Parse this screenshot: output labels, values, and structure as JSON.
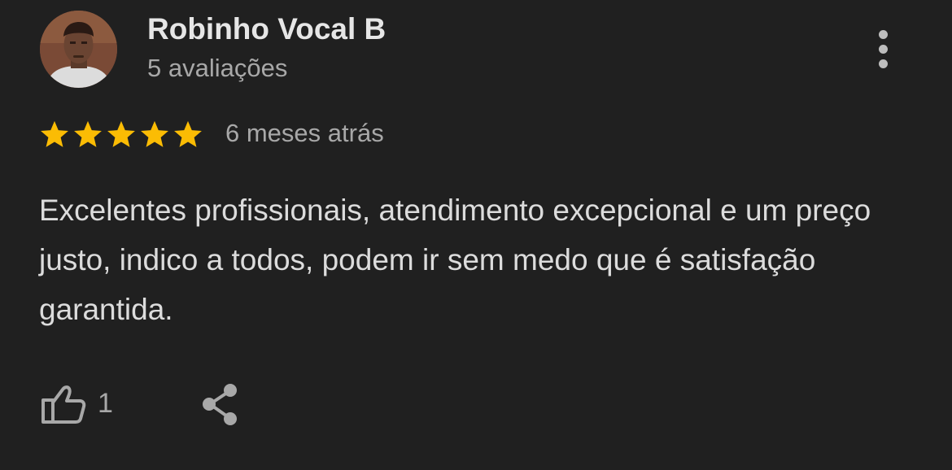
{
  "review": {
    "author": {
      "name": "Robinho Vocal B",
      "review_count": "5 avaliações",
      "avatar_icon": "user-photo"
    },
    "rating": {
      "stars": 5,
      "max": 5,
      "star_color": "#FBBC04"
    },
    "date": "6 meses atrás",
    "text": "Excelentes profissionais, atendimento excepcional e um preço justo, indico a todos, podem ir sem medo que é satisfação garantida.",
    "actions": {
      "like_icon": "thumbs-up-icon",
      "like_count": "1",
      "share_icon": "share-icon",
      "more_icon": "more-vert-icon"
    }
  },
  "theme": {
    "background": "#202020",
    "primary_text": "#e6e6e6",
    "secondary_text": "#a8a8a8"
  }
}
